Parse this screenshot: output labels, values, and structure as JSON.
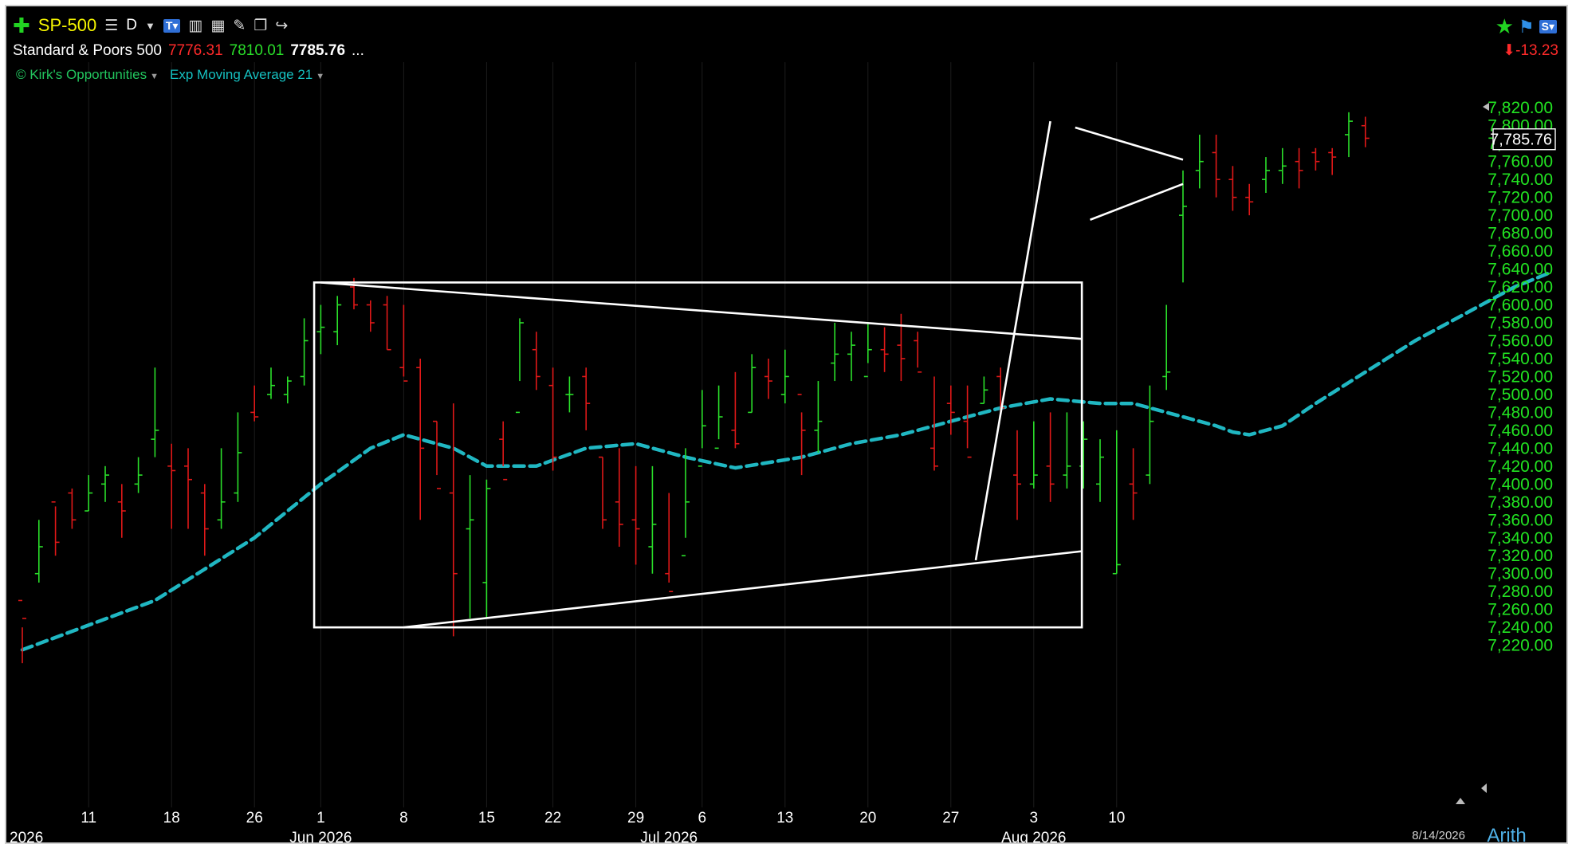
{
  "header": {
    "symbol": "SP-500",
    "period": "D",
    "name": "Standard & Poors 500",
    "low": "7776.31",
    "high": "7810.01",
    "last": "7785.76",
    "more": "...",
    "change": "-13.23",
    "indicator1": "Kirk's Opportunities",
    "indicator2": "Exp Moving Average 21",
    "copyright": "©"
  },
  "icons": [
    "plus-icon",
    "list-icon",
    "dropdown-icon",
    "tv-icon",
    "bars-icon",
    "grid-calc-icon",
    "pencil-icon",
    "stack-icon",
    "share-arrow-icon",
    "star-icon",
    "flag-icon",
    "s-menu-icon",
    "down-arrow-icon"
  ],
  "colors": {
    "up": "#2adf2a",
    "down": "#e01818",
    "ema": "#20b7c2",
    "annotation": "#ffffff",
    "axis_label": "#22e422",
    "background": "#000000"
  },
  "footer": {
    "date": "8/14/2026",
    "scale": "Arith"
  },
  "chart_data": {
    "type": "ohlc",
    "title": "SP-500",
    "ylim": [
      7210,
      7830
    ],
    "y_ticks": [
      7220,
      7240,
      7260,
      7280,
      7300,
      7320,
      7340,
      7360,
      7380,
      7400,
      7420,
      7440,
      7460,
      7480,
      7500,
      7520,
      7540,
      7560,
      7580,
      7600,
      7620,
      7640,
      7660,
      7680,
      7700,
      7720,
      7740,
      7760,
      7780,
      7800,
      7820
    ],
    "y_tick_labels": [
      "7,220.00",
      "7,240.00",
      "7,260.00",
      "7,280.00",
      "7,300.00",
      "7,320.00",
      "7,340.00",
      "7,360.00",
      "7,380.00",
      "7,400.00",
      "7,420.00",
      "7,440.00",
      "7,460.00",
      "7,480.00",
      "7,500.00",
      "7,520.00",
      "7,540.00",
      "7,560.00",
      "7,580.00",
      "7,600.00",
      "7,620.00",
      "7,640.00",
      "7,660.00",
      "7,680.00",
      "7,700.00",
      "7,720.00",
      "7,740.00",
      "7,760.00",
      "7,780.00",
      "7,800.00",
      "7,820.00"
    ],
    "last_price_label": "7,785.76",
    "x_tick_labels": [
      {
        "i": 4,
        "label": "11"
      },
      {
        "i": 9,
        "label": "18"
      },
      {
        "i": 14,
        "label": "26"
      },
      {
        "i": 18,
        "label": "1"
      },
      {
        "i": 23,
        "label": "8"
      },
      {
        "i": 28,
        "label": "15"
      },
      {
        "i": 32,
        "label": "22"
      },
      {
        "i": 37,
        "label": "29"
      },
      {
        "i": 41,
        "label": "6"
      },
      {
        "i": 46,
        "label": "13"
      },
      {
        "i": 51,
        "label": "20"
      },
      {
        "i": 56,
        "label": "27"
      },
      {
        "i": 61,
        "label": "3"
      },
      {
        "i": 66,
        "label": "10"
      }
    ],
    "month_labels": [
      {
        "i": 0,
        "label": "2026"
      },
      {
        "i": 18,
        "label": "Jun 2026"
      },
      {
        "i": 39,
        "label": "Jul 2026"
      },
      {
        "i": 61,
        "label": "Aug 2026"
      }
    ],
    "bars": [
      [
        7270,
        7250,
        7200,
        7240
      ],
      [
        7300,
        7330,
        7290,
        7360
      ],
      [
        7380,
        7335,
        7320,
        7375
      ],
      [
        7390,
        7360,
        7350,
        7395
      ],
      [
        7370,
        7390,
        7370,
        7410
      ],
      [
        7400,
        7410,
        7380,
        7420
      ],
      [
        7380,
        7370,
        7340,
        7400
      ],
      [
        7400,
        7410,
        7390,
        7430
      ],
      [
        7450,
        7460,
        7430,
        7530
      ],
      [
        7420,
        7415,
        7350,
        7445
      ],
      [
        7420,
        7405,
        7350,
        7440
      ],
      [
        7390,
        7350,
        7320,
        7400
      ],
      [
        7360,
        7380,
        7350,
        7440
      ],
      [
        7390,
        7435,
        7380,
        7480
      ],
      [
        7480,
        7475,
        7470,
        7510
      ],
      [
        7500,
        7510,
        7495,
        7530
      ],
      [
        7500,
        7515,
        7490,
        7520
      ],
      [
        7520,
        7560,
        7510,
        7585
      ],
      [
        7570,
        7575,
        7545,
        7600
      ],
      [
        7570,
        7600,
        7555,
        7610
      ],
      [
        7620,
        7600,
        7595,
        7630
      ],
      [
        7600,
        7580,
        7570,
        7605
      ],
      [
        7600,
        7550,
        7550,
        7610
      ],
      [
        7530,
        7515,
        7520,
        7600
      ],
      [
        7530,
        7440,
        7360,
        7540
      ],
      [
        7470,
        7395,
        7410,
        7470
      ],
      [
        7390,
        7300,
        7230,
        7490
      ],
      [
        7350,
        7360,
        7250,
        7410
      ],
      [
        7290,
        7395,
        7250,
        7405
      ],
      [
        7450,
        7405,
        7420,
        7470
      ],
      [
        7480,
        7580,
        7515,
        7585
      ],
      [
        7550,
        7520,
        7505,
        7570
      ],
      [
        7510,
        7430,
        7415,
        7530
      ],
      [
        7500,
        7500,
        7480,
        7520
      ],
      [
        7520,
        7490,
        7460,
        7530
      ],
      [
        7430,
        7360,
        7350,
        7430
      ],
      [
        7380,
        7355,
        7330,
        7440
      ],
      [
        7360,
        7350,
        7310,
        7420
      ],
      [
        7330,
        7355,
        7300,
        7420
      ],
      [
        7300,
        7280,
        7290,
        7390
      ],
      [
        7320,
        7380,
        7340,
        7440
      ],
      [
        7420,
        7465,
        7440,
        7505
      ],
      [
        7440,
        7475,
        7450,
        7510
      ],
      [
        7460,
        7445,
        7440,
        7525
      ],
      [
        7480,
        7530,
        7480,
        7545
      ],
      [
        7520,
        7515,
        7495,
        7540
      ],
      [
        7500,
        7520,
        7490,
        7550
      ],
      [
        7500,
        7460,
        7410,
        7480
      ],
      [
        7460,
        7470,
        7435,
        7515
      ],
      [
        7535,
        7545,
        7515,
        7580
      ],
      [
        7545,
        7555,
        7515,
        7570
      ],
      [
        7520,
        7550,
        7535,
        7580
      ],
      [
        7550,
        7545,
        7525,
        7575
      ],
      [
        7555,
        7540,
        7515,
        7590
      ],
      [
        7560,
        7525,
        7530,
        7570
      ],
      [
        7440,
        7420,
        7415,
        7520
      ],
      [
        7490,
        7480,
        7455,
        7510
      ],
      [
        7470,
        7430,
        7440,
        7510
      ],
      [
        7490,
        7505,
        7490,
        7520
      ],
      [
        7520,
        7485,
        7480,
        7530
      ],
      [
        7410,
        7400,
        7360,
        7460
      ],
      [
        7400,
        7410,
        7395,
        7470
      ],
      [
        7420,
        7400,
        7380,
        7480
      ],
      [
        7410,
        7420,
        7395,
        7480
      ],
      [
        7420,
        7450,
        7395,
        7470
      ],
      [
        7400,
        7430,
        7380,
        7450
      ],
      [
        7300,
        7310,
        7300,
        7460
      ],
      [
        7400,
        7390,
        7360,
        7440
      ],
      [
        7410,
        7470,
        7400,
        7510
      ],
      [
        7520,
        7525,
        7505,
        7600
      ],
      [
        7700,
        7710,
        7625,
        7750
      ],
      [
        7750,
        7760,
        7730,
        7790
      ],
      [
        7770,
        7740,
        7720,
        7790
      ],
      [
        7740,
        7720,
        7705,
        7755
      ],
      [
        7720,
        7715,
        7700,
        7735
      ],
      [
        7740,
        7750,
        7725,
        7765
      ],
      [
        7750,
        7755,
        7735,
        7775
      ],
      [
        7760,
        7750,
        7730,
        7775
      ],
      [
        7770,
        7760,
        7750,
        7775
      ],
      [
        7770,
        7765,
        7745,
        7775
      ],
      [
        7790,
        7805,
        7765,
        7815
      ],
      [
        7800,
        7786,
        7776,
        7810
      ]
    ],
    "ema": [
      [
        0,
        7215
      ],
      [
        8,
        7270
      ],
      [
        14,
        7340
      ],
      [
        18,
        7400
      ],
      [
        21,
        7440
      ],
      [
        23,
        7455
      ],
      [
        26,
        7440
      ],
      [
        28,
        7420
      ],
      [
        31,
        7420
      ],
      [
        34,
        7440
      ],
      [
        37,
        7445
      ],
      [
        40,
        7430
      ],
      [
        43,
        7418
      ],
      [
        47,
        7430
      ],
      [
        50,
        7445
      ],
      [
        53,
        7455
      ],
      [
        56,
        7470
      ],
      [
        59,
        7485
      ],
      [
        62,
        7495
      ],
      [
        65,
        7490
      ],
      [
        67,
        7490
      ],
      [
        70,
        7475
      ],
      [
        72,
        7465
      ],
      [
        73,
        7458
      ],
      [
        74,
        7455
      ],
      [
        76,
        7465
      ],
      [
        78,
        7490
      ],
      [
        81,
        7525
      ],
      [
        84,
        7560
      ],
      [
        87,
        7590
      ],
      [
        90,
        7620
      ],
      [
        92,
        7635
      ]
    ],
    "annotations": {
      "rectangle": {
        "x0": 17.6,
        "x1": 63.9,
        "y0": 7240,
        "y1": 7625
      },
      "upper_trend": [
        [
          18.0,
          7625
        ],
        [
          63.9,
          7562
        ]
      ],
      "lower_trend": [
        [
          23.0,
          7240
        ],
        [
          63.9,
          7325
        ]
      ],
      "breakout_line": [
        [
          57.5,
          7315
        ],
        [
          62.0,
          7805
        ]
      ],
      "pennant_top": [
        [
          63.5,
          7798
        ],
        [
          70.0,
          7762
        ]
      ],
      "pennant_bottom": [
        [
          64.4,
          7695
        ],
        [
          70.0,
          7735
        ]
      ]
    }
  }
}
